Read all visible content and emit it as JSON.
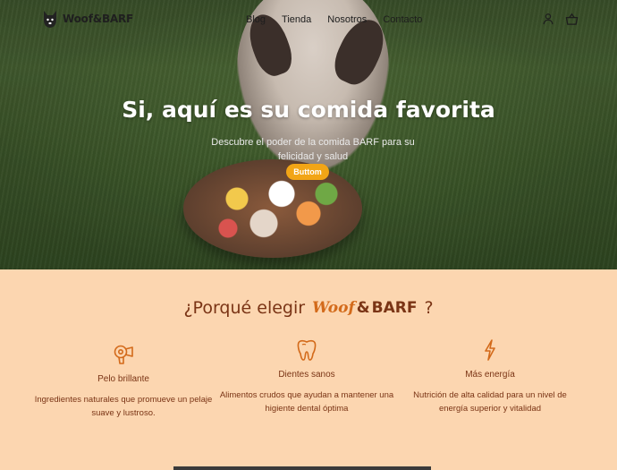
{
  "brand": {
    "logo_text": "Woof&BARF"
  },
  "nav": {
    "links": [
      "Blog",
      "Tienda",
      "Nosotros",
      "Contacto"
    ],
    "icons": [
      "user-icon",
      "shopping-basket-icon"
    ]
  },
  "hero": {
    "title": "Si, aquí es su comida favorita",
    "subtitle": "Descubre el poder de la comida BARF para su felicidad y salud",
    "button_label": "Buttom"
  },
  "why": {
    "title_prefix": "¿Porqué elegir",
    "brand_w": "Woof",
    "brand_amp": "&",
    "brand_rest": "BARF",
    "title_suffix": "?"
  },
  "features": [
    {
      "icon": "hair-dryer-icon",
      "title": "Pelo brillante",
      "description": "Ingredientes naturales que promueve un pelaje  suave y lustroso."
    },
    {
      "icon": "tooth-icon",
      "title": "Dientes sanos",
      "description": "Alimentos crudos que ayudan a mantener una higiente dental óptima"
    },
    {
      "icon": "lightning-icon",
      "title": "Más energía",
      "description": "Nutrición de alta calidad para un nivel de energía superior y vitalidad"
    }
  ],
  "colors": {
    "accent": "#f2a516",
    "section_bg": "#fcd6b0",
    "brown_text": "#7a3415",
    "icon_orange": "#d36a1a"
  }
}
